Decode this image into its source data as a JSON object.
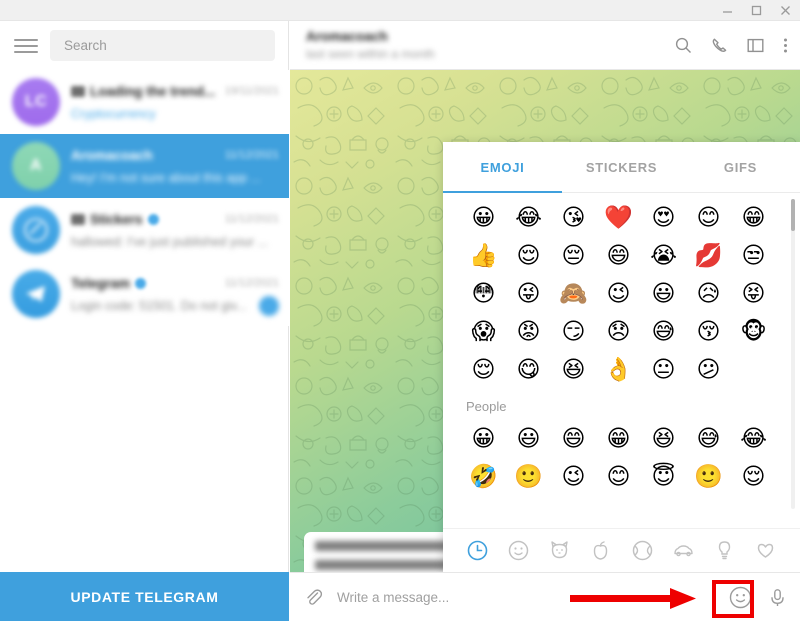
{
  "window": {
    "controls": [
      {
        "name": "minimize",
        "glyph": "minimize-icon"
      },
      {
        "name": "maximize",
        "glyph": "maximize-icon"
      },
      {
        "name": "close",
        "glyph": "close-icon"
      }
    ]
  },
  "sidebar": {
    "menu_icon": "hamburger-menu-icon",
    "search": {
      "placeholder": "Search",
      "value": ""
    },
    "chats": [
      {
        "name": "Loading the trend...",
        "time": "19/11/2021",
        "message": "Cryptocurrency",
        "avatar_initials": "LC",
        "avatar_color": "#a77bf0",
        "selected": false,
        "verified": false,
        "muted": true,
        "message_is_link": true,
        "badge": ""
      },
      {
        "name": "Aromacoach",
        "time": "11/12/2021",
        "message": "Hey! I'm not sure about this app ...",
        "avatar_initials": "A",
        "avatar_color": "#8ed8b6",
        "selected": true,
        "verified": false,
        "muted": false,
        "message_is_link": false,
        "badge": ""
      },
      {
        "name": "Stickers",
        "time": "11/12/2021",
        "message": "hallowed: I've just published your ...",
        "avatar_initials": "",
        "avatar_color": "#4aaae8",
        "selected": false,
        "verified": true,
        "muted": true,
        "message_is_link": false,
        "badge": ""
      },
      {
        "name": "Telegram",
        "time": "11/12/2021",
        "message": "Login code: 51501. Do not giv...",
        "avatar_initials": "",
        "avatar_color": "#48abe8",
        "selected": false,
        "verified": true,
        "muted": false,
        "message_is_link": false,
        "badge": "1"
      }
    ],
    "update_button": "UPDATE TELEGRAM"
  },
  "chat_header": {
    "title": "Aromacoach",
    "status": "last seen within a month",
    "icons": [
      "search-icon",
      "phone-icon",
      "panel-icon",
      "more-vertical-icon"
    ]
  },
  "conversation": {
    "messages": [
      {
        "line1": "Hey! I'm not sure abo",
        "line2": "not sure how private"
      }
    ]
  },
  "emoji_panel": {
    "tabs": [
      {
        "label": "EMOJI",
        "active": true
      },
      {
        "label": "STICKERS",
        "active": false
      },
      {
        "label": "GIFS",
        "active": false
      }
    ],
    "recent_rows": [
      [
        "😀",
        "😂",
        "😘",
        "❤️",
        "😍",
        "😊",
        "😁"
      ],
      [
        "👍",
        "😌",
        "😔",
        "😄",
        "😭",
        "💋",
        "😒"
      ],
      [
        "😳",
        "😜",
        "🙈",
        "😉",
        "😃",
        "😥",
        "😝"
      ],
      [
        "😱",
        "😡",
        "😏",
        "😞",
        "😅",
        "😚",
        "🐵"
      ],
      [
        "😌",
        "😋",
        "😆",
        "👌",
        "😐",
        "😕"
      ]
    ],
    "section_label": "People",
    "people_rows": [
      [
        "😀",
        "😃",
        "😄",
        "😁",
        "😆",
        "😅",
        "😂"
      ],
      [
        "🤣",
        "🙂",
        "😉",
        "😊",
        "😇",
        "🙂",
        "😌"
      ]
    ],
    "categories": [
      {
        "name": "recent-icon",
        "active": true
      },
      {
        "name": "people-icon",
        "active": false
      },
      {
        "name": "animals-icon",
        "active": false
      },
      {
        "name": "food-icon",
        "active": false
      },
      {
        "name": "activity-icon",
        "active": false
      },
      {
        "name": "travel-icon",
        "active": false
      },
      {
        "name": "objects-icon",
        "active": false
      },
      {
        "name": "symbols-icon",
        "active": false
      }
    ]
  },
  "composer": {
    "attach_icon": "paperclip-icon",
    "placeholder": "Write a message...",
    "value": "",
    "emoji_icon": "smiley-face-icon",
    "mic_icon": "microphone-icon"
  },
  "annotation": {
    "highlight_color": "#ee0000",
    "arrow": "red-arrow-right",
    "target": "emoji-button"
  }
}
